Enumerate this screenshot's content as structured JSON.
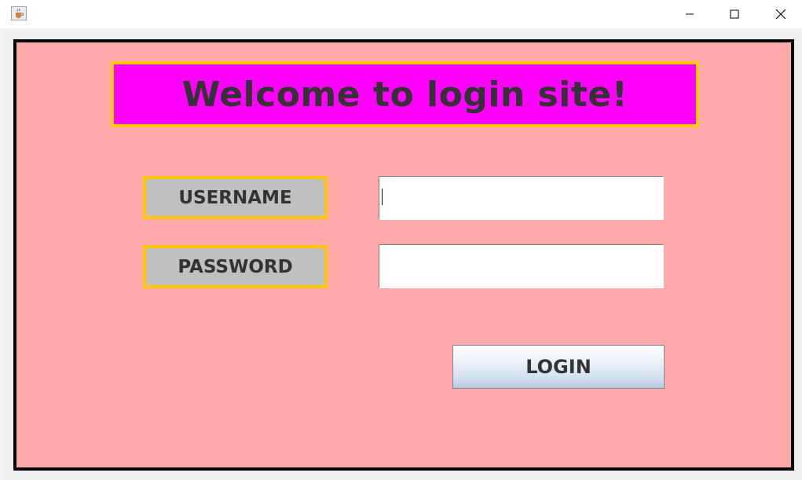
{
  "window": {
    "icon": "java-cup-icon",
    "controls": {
      "minimize_icon": "minimize-icon",
      "maximize_icon": "maximize-icon",
      "close_icon": "close-icon"
    }
  },
  "banner": {
    "title": "Welcome to login site!"
  },
  "form": {
    "username_label": "USERNAME",
    "password_label": "PASSWORD",
    "username_value": "",
    "password_value": "",
    "login_label": "LOGIN"
  },
  "colors": {
    "panel_background": "#ffaaaa",
    "banner_background": "#ff00ff",
    "label_border": "#ffc800",
    "label_background": "#c0c0c0",
    "text": "#333333"
  }
}
